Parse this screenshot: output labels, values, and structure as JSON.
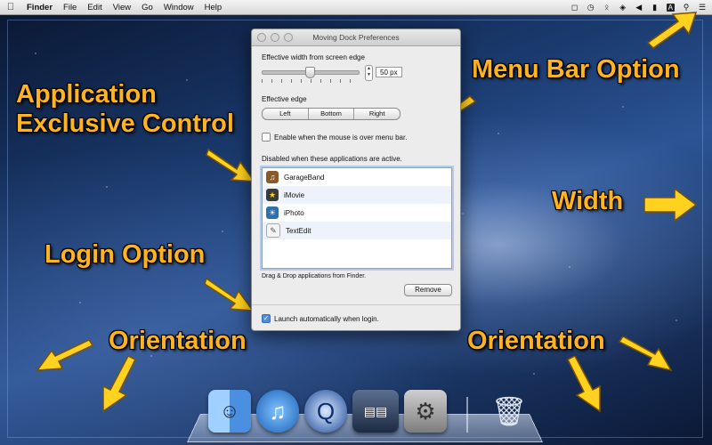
{
  "menubar": {
    "apple_icon": "apple-logo-icon",
    "items": [
      "Finder",
      "File",
      "Edit",
      "View",
      "Go",
      "Window",
      "Help"
    ],
    "status_icons": [
      "time-machine-icon",
      "clock-icon",
      "bluetooth-icon",
      "wifi-icon",
      "volume-icon",
      "battery-icon",
      "input-source-icon",
      "spotlight-icon",
      "list-menu-icon"
    ],
    "input_source_label": "A"
  },
  "callouts": {
    "application_control": [
      "Application",
      "Exclusive Control"
    ],
    "menu_bar_option": "Menu Bar Option",
    "width": "Width",
    "login_option": "Login Option",
    "orientation_left": "Orientation",
    "orientation_right": "Orientation"
  },
  "window": {
    "title": "Moving Dock Preferences",
    "width_label": "Effective width from screen edge",
    "width_value": "50 px",
    "edge_label": "Effective edge",
    "edge_options": [
      "Left",
      "Bottom",
      "Right"
    ],
    "menu_bar_checkbox": "Enable when the mouse is over menu bar.",
    "disabled_label": "Disabled when these applications are active.",
    "apps": [
      {
        "name": "GarageBand",
        "icon": "garageband-icon"
      },
      {
        "name": "iMovie",
        "icon": "imovie-icon"
      },
      {
        "name": "iPhoto",
        "icon": "iphoto-icon"
      },
      {
        "name": "TextEdit",
        "icon": "textedit-icon"
      }
    ],
    "drag_hint": "Drag & Drop applications from Finder.",
    "remove_button": "Remove",
    "launch_checkbox": "Launch automatically when login."
  },
  "dock": {
    "items": [
      "finder-icon",
      "itunes-icon",
      "quicktime-icon",
      "mission-control-icon",
      "system-preferences-icon",
      "trash-icon"
    ]
  },
  "colors": {
    "callout_text": "#ffb321",
    "arrow_fill": "#ffd21f"
  }
}
